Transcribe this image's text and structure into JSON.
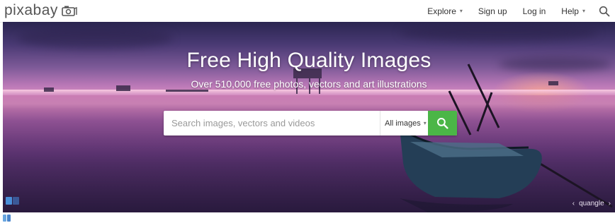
{
  "brand": {
    "logo_text": "pixabay",
    "accent_color": "#4bb647"
  },
  "nav": {
    "explore_label": "Explore",
    "signup_label": "Sign up",
    "login_label": "Log in",
    "help_label": "Help",
    "search_icon": "search-icon"
  },
  "hero": {
    "title": "Free High Quality Images",
    "subtitle": "Over 510,000 free photos, vectors and art illustrations",
    "search": {
      "placeholder": "Search images, vectors and videos",
      "value": "",
      "type_selected": "All images",
      "button_icon": "search-icon"
    },
    "photo_credit": "quangle"
  }
}
